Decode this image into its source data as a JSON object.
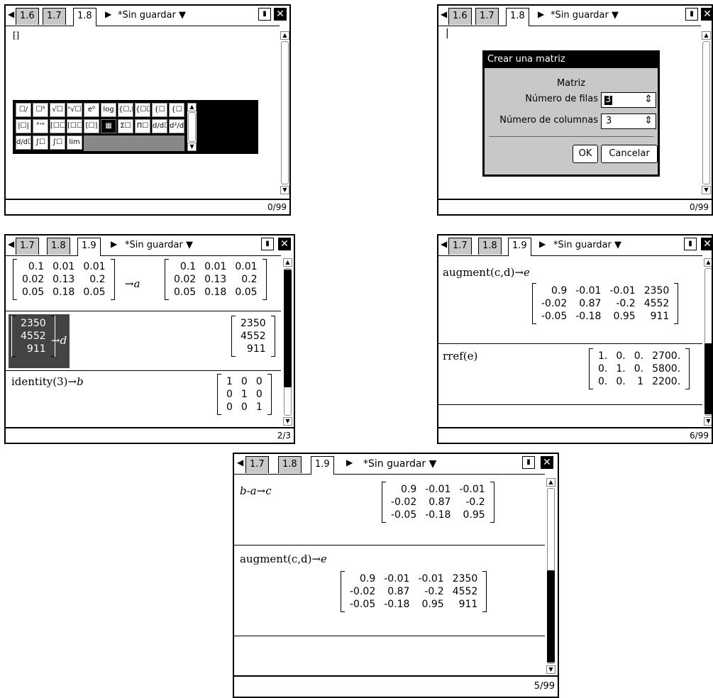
{
  "screen1": {
    "tabs": [
      "1.6",
      "1.7",
      "1.8"
    ],
    "doc_title": "*Sin guardar",
    "status": "0/99",
    "palette": {
      "row1": [
        "☐/☐",
        "☐⁰",
        "√☐",
        "ⁿ√☐",
        "e⁰",
        "log",
        "{☐,☐",
        "{☐☐",
        "{☐",
        "{☐"
      ],
      "row2": [
        "|☐|",
        "°'\"",
        "[☐☐]",
        "[☐☐]",
        "[☐]",
        "▦",
        "Σ☐",
        "Π☐",
        "d/d☐",
        "d²/d☐"
      ],
      "row3": [
        "d/d☐",
        "∫☐",
        "∫☐",
        "lim"
      ]
    }
  },
  "screen2": {
    "tabs": [
      "1.6",
      "1.7",
      "1.8"
    ],
    "doc_title": "*Sin guardar",
    "status": "0/99",
    "dialog": {
      "title": "Crear una matriz",
      "heading": "Matriz",
      "rows_label": "Número de filas",
      "rows_value": "3",
      "cols_label": "Número de columnas",
      "cols_value": "3",
      "ok": "OK",
      "cancel": "Cancelar"
    }
  },
  "screen3": {
    "tabs": [
      "1.7",
      "1.8",
      "1.9"
    ],
    "doc_title": "*Sin guardar",
    "status": "2/3",
    "arrow_a": "→a",
    "arrow_d": "→d",
    "identity_expr": "identity(3)",
    "arrow_b": "→b",
    "matrix_a": [
      [
        "0.1",
        "0.01",
        "0.01"
      ],
      [
        "0.02",
        "0.13",
        "0.2"
      ],
      [
        "0.05",
        "0.18",
        "0.05"
      ]
    ],
    "vector_d": [
      "2350",
      "4552",
      "911"
    ],
    "identity": [
      [
        "1",
        "0",
        "0"
      ],
      [
        "0",
        "1",
        "0"
      ],
      [
        "0",
        "0",
        "1"
      ]
    ]
  },
  "screen4": {
    "tabs": [
      "1.7",
      "1.8",
      "1.9"
    ],
    "doc_title": "*Sin guardar",
    "status": "6/99",
    "augment_expr": "augment(c,d)",
    "arrow_e": "→e",
    "rref_expr": "rref(e)",
    "matrix_e": [
      [
        "0.9",
        "-0.01",
        "-0.01",
        "2350"
      ],
      [
        "-0.02",
        "0.87",
        "-0.2",
        "4552"
      ],
      [
        "-0.05",
        "-0.18",
        "0.95",
        "911"
      ]
    ],
    "matrix_rref": [
      [
        "1.",
        "0.",
        "0.",
        "2700."
      ],
      [
        "0.",
        "1.",
        "0.",
        "5800."
      ],
      [
        "0.",
        "0.",
        "1",
        "2200."
      ]
    ]
  },
  "screen5": {
    "tabs": [
      "1.7",
      "1.8",
      "1.9"
    ],
    "doc_title": "*Sin guardar",
    "status": "5/99",
    "bac_expr": "b-a",
    "arrow_c": "→c",
    "augment_expr": "augment(c,d)",
    "arrow_e": "→e",
    "matrix_c": [
      [
        "0.9",
        "-0.01",
        "-0.01"
      ],
      [
        "-0.02",
        "0.87",
        "-0.2"
      ],
      [
        "-0.05",
        "-0.18",
        "0.95"
      ]
    ],
    "matrix_e": [
      [
        "0.9",
        "-0.01",
        "-0.01",
        "2350"
      ],
      [
        "-0.02",
        "0.87",
        "-0.2",
        "4552"
      ],
      [
        "-0.05",
        "-0.18",
        "0.95",
        "911"
      ]
    ]
  }
}
